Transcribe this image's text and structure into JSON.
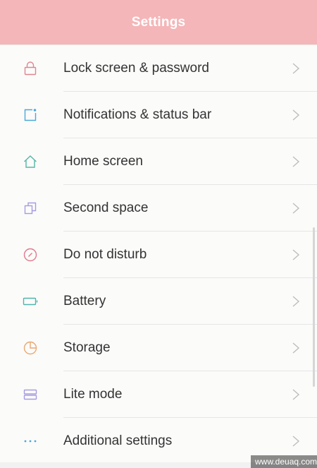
{
  "header": {
    "title": "Settings",
    "color": "#f4b6b8"
  },
  "items": [
    {
      "label": "Lock screen & password",
      "icon": "lock-icon",
      "icon_color": "#e0868f"
    },
    {
      "label": "Notifications & status bar",
      "icon": "notification-icon",
      "icon_color": "#4aa9d8"
    },
    {
      "label": "Home screen",
      "icon": "home-icon",
      "icon_color": "#56b7a5"
    },
    {
      "label": "Second space",
      "icon": "second-space-icon",
      "icon_color": "#a89be0"
    },
    {
      "label": "Do not disturb",
      "icon": "do-not-disturb-icon",
      "icon_color": "#e07a8a"
    },
    {
      "label": "Battery",
      "icon": "battery-icon",
      "icon_color": "#4fb6ae"
    },
    {
      "label": "Storage",
      "icon": "storage-icon",
      "icon_color": "#eba870"
    },
    {
      "label": "Lite mode",
      "icon": "lite-mode-icon",
      "icon_color": "#a89be0"
    },
    {
      "label": "Additional settings",
      "icon": "more-icon",
      "icon_color": "#4aa9d8"
    }
  ],
  "watermark": "www.deuaq.com"
}
